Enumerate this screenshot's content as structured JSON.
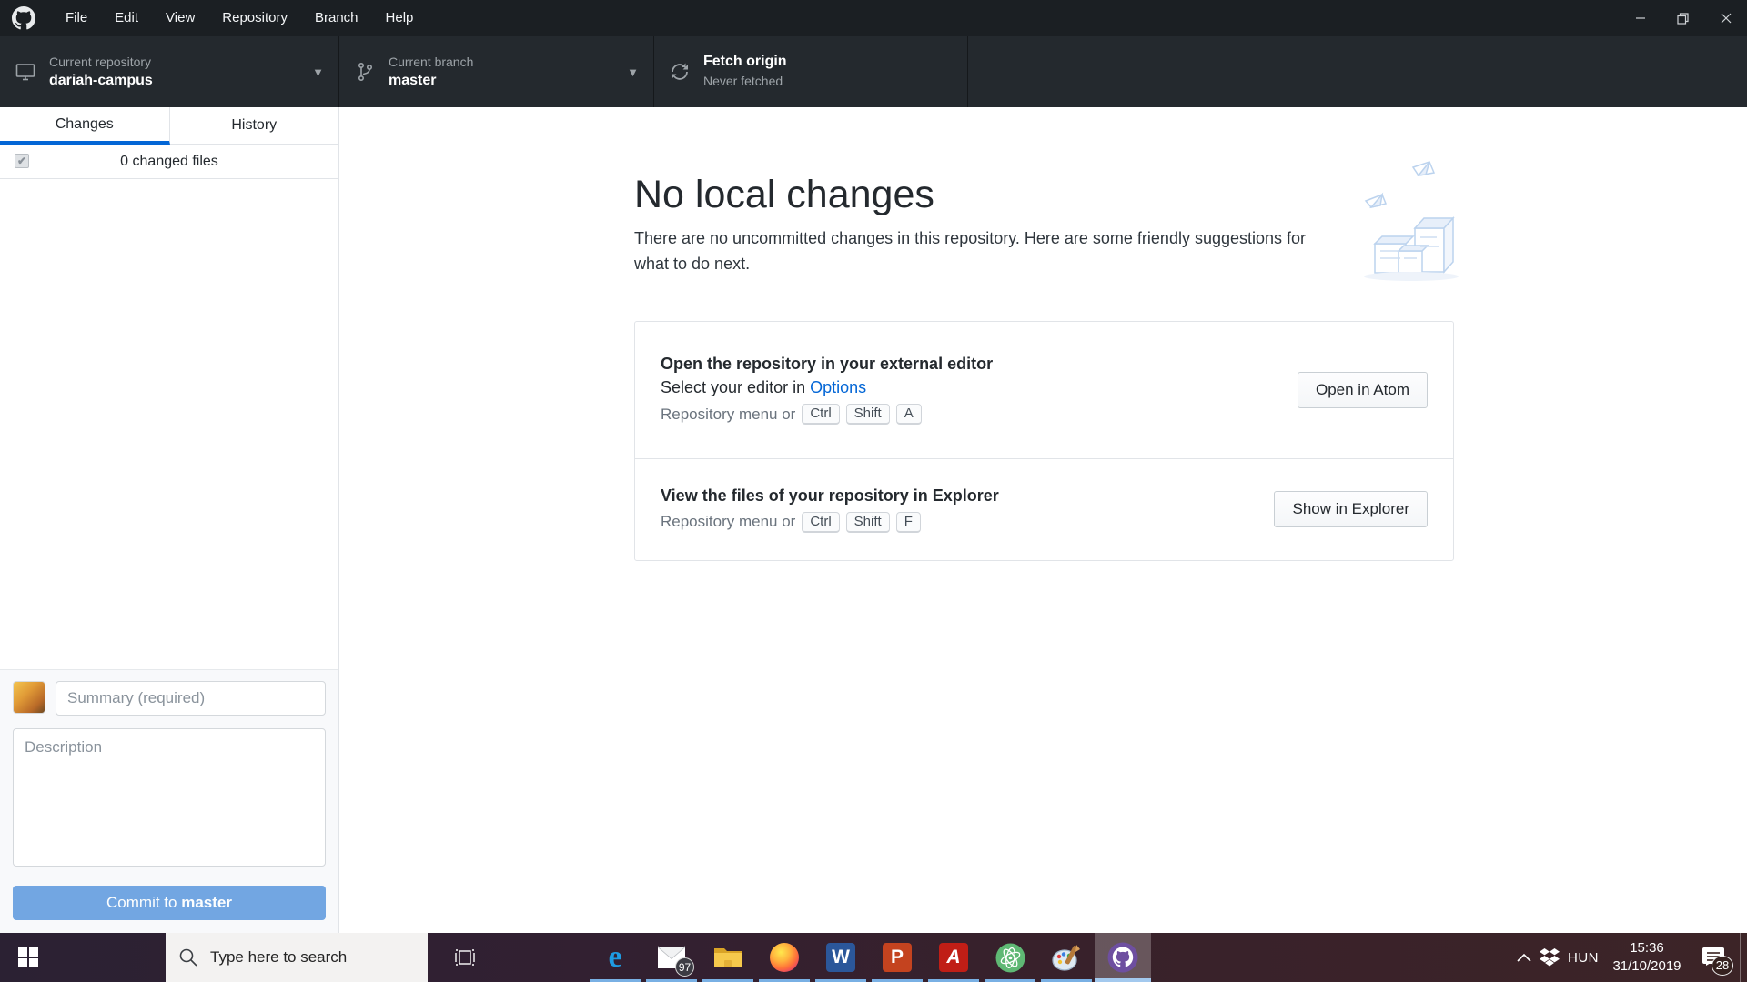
{
  "titlebar": {
    "menu": [
      "File",
      "Edit",
      "View",
      "Repository",
      "Branch",
      "Help"
    ]
  },
  "toolbar": {
    "repo": {
      "label": "Current repository",
      "value": "dariah-campus"
    },
    "branch": {
      "label": "Current branch",
      "value": "master"
    },
    "fetch": {
      "label": "Fetch origin",
      "status": "Never fetched"
    }
  },
  "sidebar": {
    "tabs": [
      {
        "label": "Changes"
      },
      {
        "label": "History"
      }
    ],
    "changed_files": "0 changed files",
    "commit": {
      "summary_placeholder": "Summary (required)",
      "description_placeholder": "Description",
      "button_prefix": "Commit to ",
      "button_branch": "master"
    }
  },
  "main": {
    "title": "No local changes",
    "subtitle": "There are no uncommitted changes in this repository. Here are some friendly suggestions for what to do next.",
    "cards": [
      {
        "title": "Open the repository in your external editor",
        "line2_prefix": "Select your editor in ",
        "line2_link": "Options",
        "shortcut_prefix": "Repository menu or",
        "keys": [
          "Ctrl",
          "Shift",
          "A"
        ],
        "button": "Open in Atom"
      },
      {
        "title": "View the files of your repository in Explorer",
        "shortcut_prefix": "Repository menu or",
        "keys": [
          "Ctrl",
          "Shift",
          "F"
        ],
        "button": "Show in Explorer"
      }
    ]
  },
  "taskbar": {
    "search_placeholder": "Type here to search",
    "mail_badge": "97",
    "word_letter": "W",
    "ppt_letter": "P",
    "acrobat_letter": "A",
    "edge_letter": "e",
    "tray": {
      "language": "HUN",
      "time": "15:36",
      "date": "31/10/2019",
      "notification_badge": "28"
    }
  },
  "colors": {
    "accent_blue": "#0366d6",
    "commit_button_blue": "#72a6e2",
    "header_dark": "#24292e",
    "titlebar_dark": "#1b1f23",
    "taskbar_underline": "#79b0e4",
    "github_desktop_purple": "#6e4fa0"
  }
}
